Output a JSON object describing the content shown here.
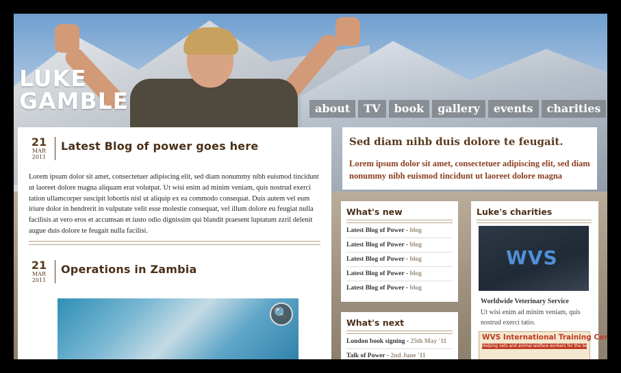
{
  "site": {
    "logo_line1": "LUKE",
    "logo_line2": "GAMBLE"
  },
  "nav": [
    "about",
    "TV",
    "book",
    "gallery",
    "events",
    "charities"
  ],
  "posts": [
    {
      "day": "21",
      "month": "MAR",
      "year": "2011",
      "title": "Latest Blog of power goes here",
      "body": "Lorem ipsum dolor sit amet, consectetuer adipiscing elit, sed diam nonummy nibh euismod tincidunt ut laoreet dolore magna aliquam erat volutpat. Ut wisi enim ad minim veniam, quis nostrud exerci tation ullamcorper suscipit lobortis nisl ut aliquip ex ea commodo consequat. Duis autem vel eum iriure dolor in hendrerit in vulputate velit esse molestie consequat, vel illum dolore eu feugiat nulla facilisis at vero eros et accumsan et iusto odio dignissim qui blandit praesent luptatum zzril delenit augue duis dolore te feugait nulla facilisi."
    },
    {
      "day": "21",
      "month": "MAR",
      "year": "2011",
      "title": "Operations in Zambia"
    }
  ],
  "callout": {
    "heading": "Sed diam nihb duis dolore te feugait.",
    "text": "Lorem ipsum dolor sit amet, consectetuer adipiscing elit, sed diam nonummy nibh euismod tincidunt ut laoreet dolore magna"
  },
  "whats_new": {
    "title": "What's new",
    "items": [
      {
        "label": "Latest Blog of Power",
        "tag": "blog"
      },
      {
        "label": "Latest Blog of Power",
        "tag": "blog"
      },
      {
        "label": "Latest Blog of Power",
        "tag": "blog"
      },
      {
        "label": "Latest Blog of Power",
        "tag": "blog"
      },
      {
        "label": "Latest Blog of Power",
        "tag": "blog"
      }
    ]
  },
  "whats_next": {
    "title": "What's next",
    "items": [
      {
        "label": "London book signing",
        "tag": "25th May '11"
      },
      {
        "label": "Talk of Power",
        "tag": "2nd June '11"
      }
    ]
  },
  "charities": {
    "title": "Luke's charities",
    "image_text": "WVS",
    "name": "Worldwide Veterinary Service",
    "desc": "Ut wisi enim ad minim veniam, quis nostrud exerci tatio.",
    "banner_title": "WVS International Training Centre",
    "banner_sub": "Helping vets and animal welfare workers for the benefit of all animals"
  }
}
